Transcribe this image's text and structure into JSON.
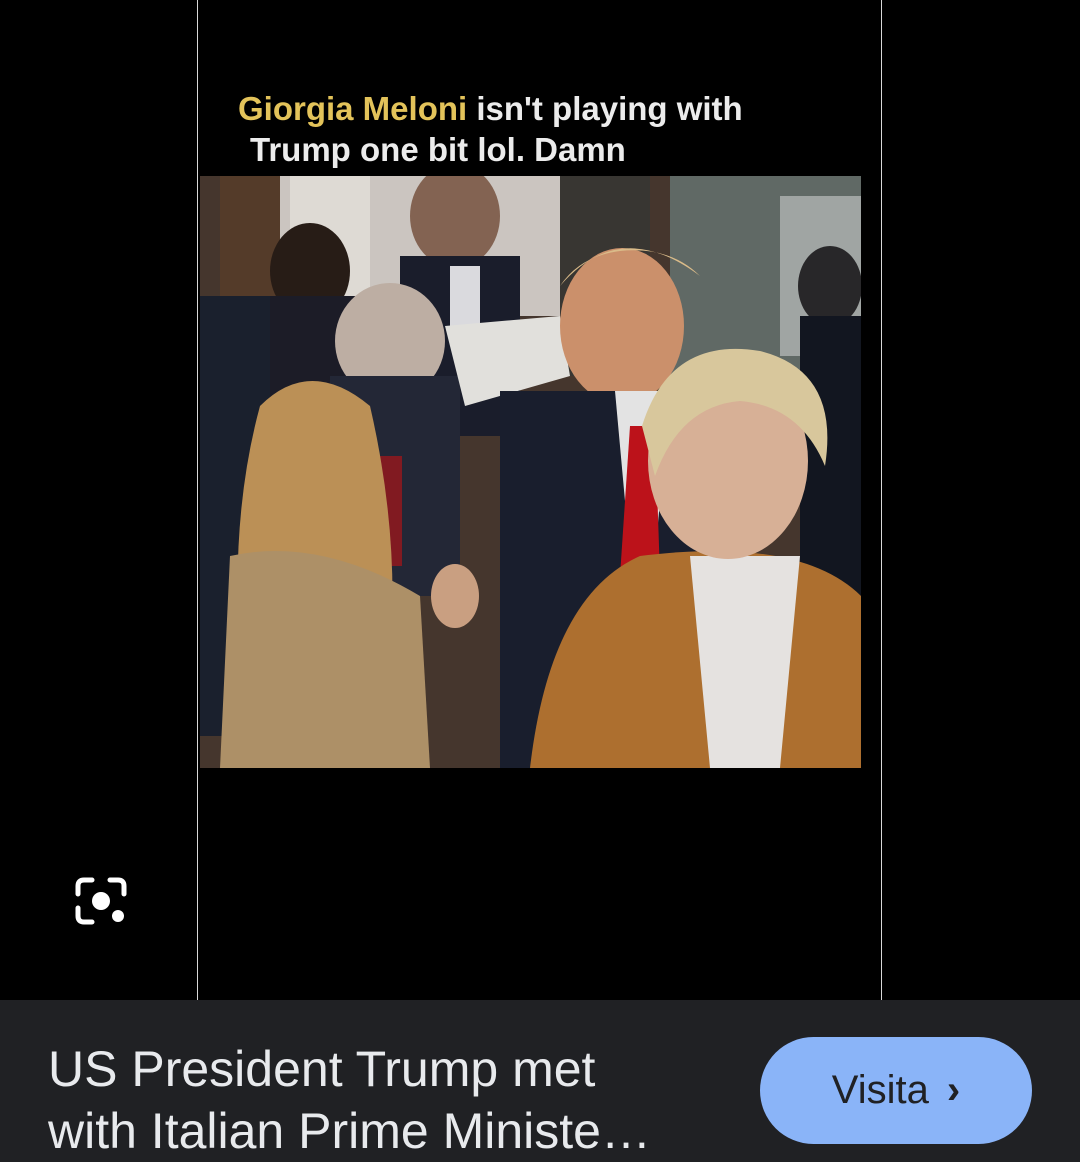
{
  "image": {
    "caption_highlight": "Giorgia Meloni",
    "caption_rest": " isn't playing with",
    "caption_line2": "Trump one bit lol.  Damn"
  },
  "result": {
    "title_line1": "US President Trump met",
    "title_line2": "with Italian Prime Ministe…",
    "visit_label": "Visita",
    "visit_chevron": "›"
  },
  "icons": {
    "lens": "google-lens-icon",
    "chevron": "chevron-right-icon"
  },
  "colors": {
    "caption_highlight": "#e3c35a",
    "bar_bg": "#202124",
    "button_bg": "#8ab4f8"
  }
}
